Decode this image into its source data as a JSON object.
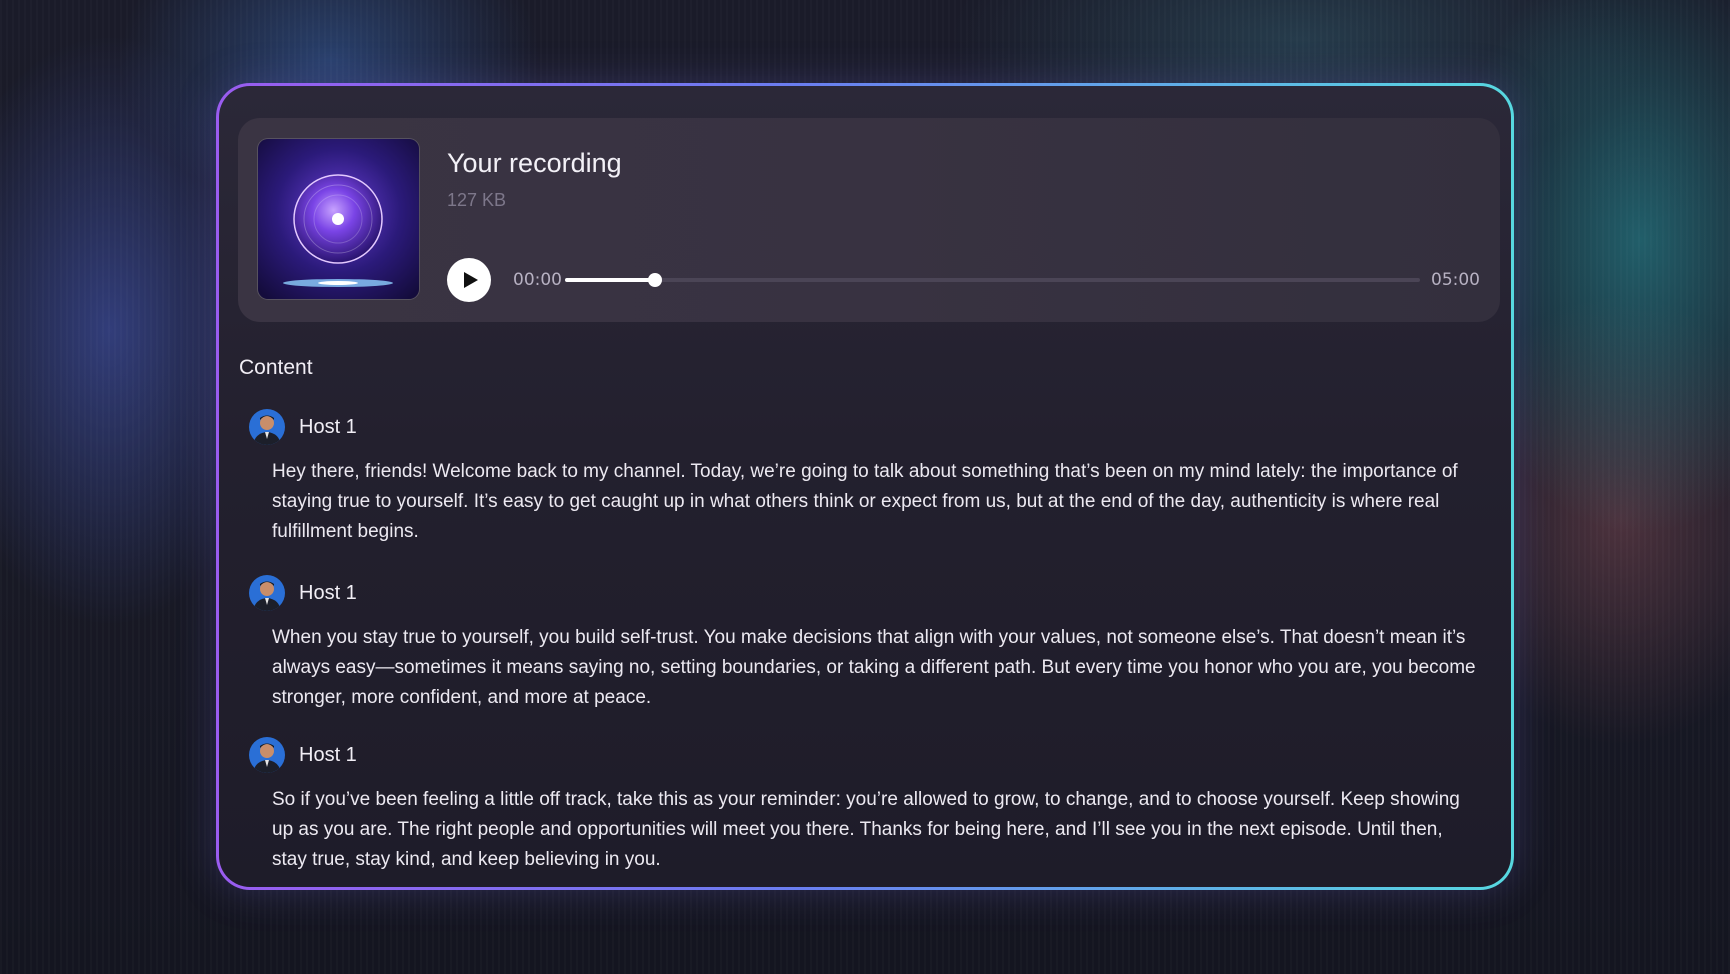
{
  "player": {
    "title": "Your recording",
    "file_size": "127 KB",
    "current_time": "00:00",
    "duration": "05:00",
    "progress": 0.105,
    "play_icon": "play-icon",
    "cover_icon": "vinyl-soundwave-art"
  },
  "content": {
    "heading": "Content",
    "entries": [
      {
        "speaker": "Host 1",
        "text": "Hey there, friends! Welcome back to my channel. Today, we’re going to talk about something that’s been on my mind lately: the importance of staying true to yourself. It’s easy to get caught up in what others think or expect from us, but at the end of the day, authenticity is where real fulfillment begins."
      },
      {
        "speaker": "Host 1",
        "text": "When you stay true to yourself, you build self-trust. You make decisions that align with your values, not someone else’s. That doesn’t mean it’s always easy—sometimes it means saying no, setting boundaries, or taking a different path. But every time you honor who you are, you become stronger, more confident, and more at peace."
      },
      {
        "speaker": "Host 1",
        "text": "So if you’ve been feeling a little off track, take this as your reminder: you’re allowed to grow, to change, and to choose yourself. Keep showing up as you are. The right people and opportunities will meet you there. Thanks for being here, and I’ll see you in the next episode. Until then, stay true, stay kind, and keep believing in you."
      }
    ]
  },
  "colors": {
    "border_start": "#9a5cf0",
    "border_end": "#57d8e0",
    "accent": "#ffffff"
  }
}
